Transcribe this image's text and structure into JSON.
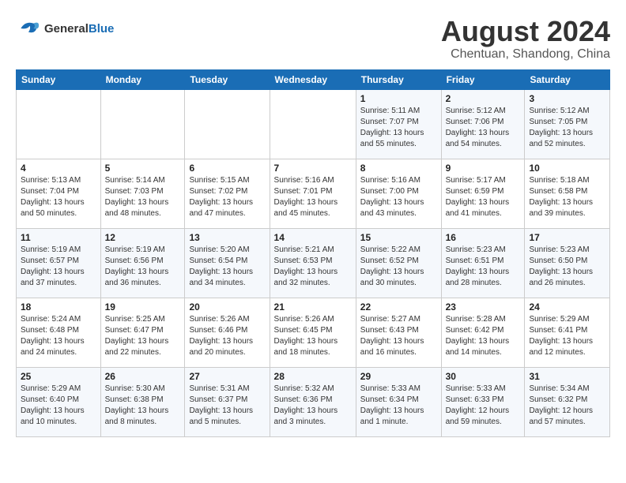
{
  "logo": {
    "line1": "General",
    "line2": "Blue"
  },
  "title": "August 2024",
  "subtitle": "Chentuan, Shandong, China",
  "headers": [
    "Sunday",
    "Monday",
    "Tuesday",
    "Wednesday",
    "Thursday",
    "Friday",
    "Saturday"
  ],
  "weeks": [
    [
      {
        "day": "",
        "detail": ""
      },
      {
        "day": "",
        "detail": ""
      },
      {
        "day": "",
        "detail": ""
      },
      {
        "day": "",
        "detail": ""
      },
      {
        "day": "1",
        "detail": "Sunrise: 5:11 AM\nSunset: 7:07 PM\nDaylight: 13 hours\nand 55 minutes."
      },
      {
        "day": "2",
        "detail": "Sunrise: 5:12 AM\nSunset: 7:06 PM\nDaylight: 13 hours\nand 54 minutes."
      },
      {
        "day": "3",
        "detail": "Sunrise: 5:12 AM\nSunset: 7:05 PM\nDaylight: 13 hours\nand 52 minutes."
      }
    ],
    [
      {
        "day": "4",
        "detail": "Sunrise: 5:13 AM\nSunset: 7:04 PM\nDaylight: 13 hours\nand 50 minutes."
      },
      {
        "day": "5",
        "detail": "Sunrise: 5:14 AM\nSunset: 7:03 PM\nDaylight: 13 hours\nand 48 minutes."
      },
      {
        "day": "6",
        "detail": "Sunrise: 5:15 AM\nSunset: 7:02 PM\nDaylight: 13 hours\nand 47 minutes."
      },
      {
        "day": "7",
        "detail": "Sunrise: 5:16 AM\nSunset: 7:01 PM\nDaylight: 13 hours\nand 45 minutes."
      },
      {
        "day": "8",
        "detail": "Sunrise: 5:16 AM\nSunset: 7:00 PM\nDaylight: 13 hours\nand 43 minutes."
      },
      {
        "day": "9",
        "detail": "Sunrise: 5:17 AM\nSunset: 6:59 PM\nDaylight: 13 hours\nand 41 minutes."
      },
      {
        "day": "10",
        "detail": "Sunrise: 5:18 AM\nSunset: 6:58 PM\nDaylight: 13 hours\nand 39 minutes."
      }
    ],
    [
      {
        "day": "11",
        "detail": "Sunrise: 5:19 AM\nSunset: 6:57 PM\nDaylight: 13 hours\nand 37 minutes."
      },
      {
        "day": "12",
        "detail": "Sunrise: 5:19 AM\nSunset: 6:56 PM\nDaylight: 13 hours\nand 36 minutes."
      },
      {
        "day": "13",
        "detail": "Sunrise: 5:20 AM\nSunset: 6:54 PM\nDaylight: 13 hours\nand 34 minutes."
      },
      {
        "day": "14",
        "detail": "Sunrise: 5:21 AM\nSunset: 6:53 PM\nDaylight: 13 hours\nand 32 minutes."
      },
      {
        "day": "15",
        "detail": "Sunrise: 5:22 AM\nSunset: 6:52 PM\nDaylight: 13 hours\nand 30 minutes."
      },
      {
        "day": "16",
        "detail": "Sunrise: 5:23 AM\nSunset: 6:51 PM\nDaylight: 13 hours\nand 28 minutes."
      },
      {
        "day": "17",
        "detail": "Sunrise: 5:23 AM\nSunset: 6:50 PM\nDaylight: 13 hours\nand 26 minutes."
      }
    ],
    [
      {
        "day": "18",
        "detail": "Sunrise: 5:24 AM\nSunset: 6:48 PM\nDaylight: 13 hours\nand 24 minutes."
      },
      {
        "day": "19",
        "detail": "Sunrise: 5:25 AM\nSunset: 6:47 PM\nDaylight: 13 hours\nand 22 minutes."
      },
      {
        "day": "20",
        "detail": "Sunrise: 5:26 AM\nSunset: 6:46 PM\nDaylight: 13 hours\nand 20 minutes."
      },
      {
        "day": "21",
        "detail": "Sunrise: 5:26 AM\nSunset: 6:45 PM\nDaylight: 13 hours\nand 18 minutes."
      },
      {
        "day": "22",
        "detail": "Sunrise: 5:27 AM\nSunset: 6:43 PM\nDaylight: 13 hours\nand 16 minutes."
      },
      {
        "day": "23",
        "detail": "Sunrise: 5:28 AM\nSunset: 6:42 PM\nDaylight: 13 hours\nand 14 minutes."
      },
      {
        "day": "24",
        "detail": "Sunrise: 5:29 AM\nSunset: 6:41 PM\nDaylight: 13 hours\nand 12 minutes."
      }
    ],
    [
      {
        "day": "25",
        "detail": "Sunrise: 5:29 AM\nSunset: 6:40 PM\nDaylight: 13 hours\nand 10 minutes."
      },
      {
        "day": "26",
        "detail": "Sunrise: 5:30 AM\nSunset: 6:38 PM\nDaylight: 13 hours\nand 8 minutes."
      },
      {
        "day": "27",
        "detail": "Sunrise: 5:31 AM\nSunset: 6:37 PM\nDaylight: 13 hours\nand 5 minutes."
      },
      {
        "day": "28",
        "detail": "Sunrise: 5:32 AM\nSunset: 6:36 PM\nDaylight: 13 hours\nand 3 minutes."
      },
      {
        "day": "29",
        "detail": "Sunrise: 5:33 AM\nSunset: 6:34 PM\nDaylight: 13 hours\nand 1 minute."
      },
      {
        "day": "30",
        "detail": "Sunrise: 5:33 AM\nSunset: 6:33 PM\nDaylight: 12 hours\nand 59 minutes."
      },
      {
        "day": "31",
        "detail": "Sunrise: 5:34 AM\nSunset: 6:32 PM\nDaylight: 12 hours\nand 57 minutes."
      }
    ]
  ]
}
